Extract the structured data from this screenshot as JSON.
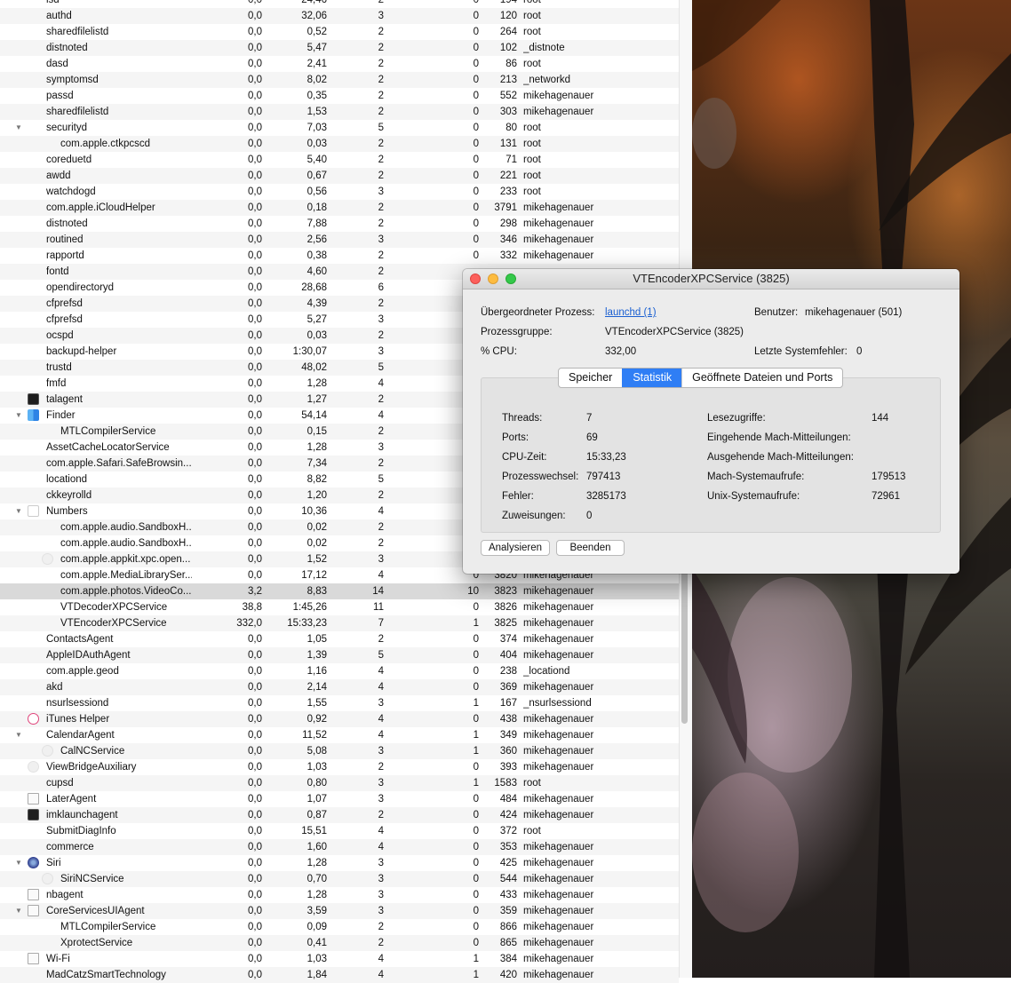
{
  "process_list": {
    "rows": [
      {
        "indent": 1,
        "name": "lsd",
        "cpu": "0,0",
        "time": "24,46",
        "threads": "2",
        "wakeups": "0",
        "pid": "194",
        "user": "root"
      },
      {
        "indent": 1,
        "name": "authd",
        "cpu": "0,0",
        "time": "32,06",
        "threads": "3",
        "wakeups": "0",
        "pid": "120",
        "user": "root"
      },
      {
        "indent": 1,
        "name": "sharedfilelistd",
        "cpu": "0,0",
        "time": "0,52",
        "threads": "2",
        "wakeups": "0",
        "pid": "264",
        "user": "root"
      },
      {
        "indent": 1,
        "name": "distnoted",
        "cpu": "0,0",
        "time": "5,47",
        "threads": "2",
        "wakeups": "0",
        "pid": "102",
        "user": "_distnote"
      },
      {
        "indent": 1,
        "name": "dasd",
        "cpu": "0,0",
        "time": "2,41",
        "threads": "2",
        "wakeups": "0",
        "pid": "86",
        "user": "root"
      },
      {
        "indent": 1,
        "name": "symptomsd",
        "cpu": "0,0",
        "time": "8,02",
        "threads": "2",
        "wakeups": "0",
        "pid": "213",
        "user": "_networkd"
      },
      {
        "indent": 1,
        "name": "passd",
        "cpu": "0,0",
        "time": "0,35",
        "threads": "2",
        "wakeups": "0",
        "pid": "552",
        "user": "mikehagenauer"
      },
      {
        "indent": 1,
        "name": "sharedfilelistd",
        "cpu": "0,0",
        "time": "1,53",
        "threads": "2",
        "wakeups": "0",
        "pid": "303",
        "user": "mikehagenauer"
      },
      {
        "indent": 1,
        "name": "securityd",
        "disclosure": "▼",
        "cpu": "0,0",
        "time": "7,03",
        "threads": "5",
        "wakeups": "0",
        "pid": "80",
        "user": "root"
      },
      {
        "indent": 2,
        "name": "com.apple.ctkpcscd",
        "cpu": "0,0",
        "time": "0,03",
        "threads": "2",
        "wakeups": "0",
        "pid": "131",
        "user": "root"
      },
      {
        "indent": 1,
        "name": "coreduetd",
        "cpu": "0,0",
        "time": "5,40",
        "threads": "2",
        "wakeups": "0",
        "pid": "71",
        "user": "root"
      },
      {
        "indent": 1,
        "name": "awdd",
        "cpu": "0,0",
        "time": "0,67",
        "threads": "2",
        "wakeups": "0",
        "pid": "221",
        "user": "root"
      },
      {
        "indent": 1,
        "name": "watchdogd",
        "cpu": "0,0",
        "time": "0,56",
        "threads": "3",
        "wakeups": "0",
        "pid": "233",
        "user": "root"
      },
      {
        "indent": 1,
        "name": "com.apple.iCloudHelper",
        "cpu": "0,0",
        "time": "0,18",
        "threads": "2",
        "wakeups": "0",
        "pid": "3791",
        "user": "mikehagenauer"
      },
      {
        "indent": 1,
        "name": "distnoted",
        "cpu": "0,0",
        "time": "7,88",
        "threads": "2",
        "wakeups": "0",
        "pid": "298",
        "user": "mikehagenauer"
      },
      {
        "indent": 1,
        "name": "routined",
        "cpu": "0,0",
        "time": "2,56",
        "threads": "3",
        "wakeups": "0",
        "pid": "346",
        "user": "mikehagenauer"
      },
      {
        "indent": 1,
        "name": "rapportd",
        "cpu": "0,0",
        "time": "0,38",
        "threads": "2",
        "wakeups": "0",
        "pid": "332",
        "user": "mikehagenauer"
      },
      {
        "indent": 1,
        "name": "fontd",
        "cpu": "0,0",
        "time": "4,60",
        "threads": "2",
        "wakeups": "",
        "pid": "",
        "user": ""
      },
      {
        "indent": 1,
        "name": "opendirectoryd",
        "cpu": "0,0",
        "time": "28,68",
        "threads": "6",
        "wakeups": "",
        "pid": "",
        "user": ""
      },
      {
        "indent": 1,
        "name": "cfprefsd",
        "cpu": "0,0",
        "time": "4,39",
        "threads": "2",
        "wakeups": "",
        "pid": "",
        "user": ""
      },
      {
        "indent": 1,
        "name": "cfprefsd",
        "cpu": "0,0",
        "time": "5,27",
        "threads": "3",
        "wakeups": "",
        "pid": "",
        "user": ""
      },
      {
        "indent": 1,
        "name": "ocspd",
        "cpu": "0,0",
        "time": "0,03",
        "threads": "2",
        "wakeups": "",
        "pid": "",
        "user": ""
      },
      {
        "indent": 1,
        "name": "backupd-helper",
        "cpu": "0,0",
        "time": "1:30,07",
        "threads": "3",
        "wakeups": "",
        "pid": "",
        "user": ""
      },
      {
        "indent": 1,
        "name": "trustd",
        "cpu": "0,0",
        "time": "48,02",
        "threads": "5",
        "wakeups": "",
        "pid": "",
        "user": ""
      },
      {
        "indent": 1,
        "name": "fmfd",
        "cpu": "0,0",
        "time": "1,28",
        "threads": "4",
        "wakeups": "",
        "pid": "",
        "user": ""
      },
      {
        "indent": 1,
        "name": "talagent",
        "icon": "terminal",
        "cpu": "0,0",
        "time": "1,27",
        "threads": "2",
        "wakeups": "",
        "pid": "",
        "user": ""
      },
      {
        "indent": 1,
        "name": "Finder",
        "icon": "finder",
        "disclosure": "▼",
        "cpu": "0,0",
        "time": "54,14",
        "threads": "4",
        "wakeups": "",
        "pid": "",
        "user": ""
      },
      {
        "indent": 2,
        "name": "MTLCompilerService",
        "cpu": "0,0",
        "time": "0,15",
        "threads": "2",
        "wakeups": "",
        "pid": "",
        "user": ""
      },
      {
        "indent": 1,
        "name": "AssetCacheLocatorService",
        "cpu": "0,0",
        "time": "1,28",
        "threads": "3",
        "wakeups": "",
        "pid": "",
        "user": ""
      },
      {
        "indent": 1,
        "name": "com.apple.Safari.SafeBrowsin...",
        "cpu": "0,0",
        "time": "7,34",
        "threads": "2",
        "wakeups": "",
        "pid": "",
        "user": ""
      },
      {
        "indent": 1,
        "name": "locationd",
        "cpu": "0,0",
        "time": "8,82",
        "threads": "5",
        "wakeups": "",
        "pid": "",
        "user": ""
      },
      {
        "indent": 1,
        "name": "ckkeyrolld",
        "cpu": "0,0",
        "time": "1,20",
        "threads": "2",
        "wakeups": "",
        "pid": "",
        "user": ""
      },
      {
        "indent": 1,
        "name": "Numbers",
        "icon": "numbers",
        "disclosure": "▼",
        "cpu": "0,0",
        "time": "10,36",
        "threads": "4",
        "wakeups": "",
        "pid": "",
        "user": ""
      },
      {
        "indent": 2,
        "name": "com.apple.audio.SandboxH...",
        "cpu": "0,0",
        "time": "0,02",
        "threads": "2",
        "wakeups": "",
        "pid": "",
        "user": ""
      },
      {
        "indent": 2,
        "name": "com.apple.audio.SandboxH...",
        "cpu": "0,0",
        "time": "0,02",
        "threads": "2",
        "wakeups": "",
        "pid": "",
        "user": ""
      },
      {
        "indent": 2,
        "name": "com.apple.appkit.xpc.open...",
        "icon": "ghost2",
        "cpu": "0,0",
        "time": "1,52",
        "threads": "3",
        "wakeups": "",
        "pid": "",
        "user": ""
      },
      {
        "indent": 2,
        "name": "com.apple.MediaLibrarySer...",
        "cpu": "0,0",
        "time": "17,12",
        "threads": "4",
        "wakeups": "0",
        "pid": "3820",
        "user": "mikehagenauer"
      },
      {
        "indent": 2,
        "name": "com.apple.photos.VideoCo...",
        "selected": true,
        "cpu": "3,2",
        "time": "8,83",
        "threads": "14",
        "wakeups": "10",
        "pid": "3823",
        "user": "mikehagenauer"
      },
      {
        "indent": 2,
        "name": "VTDecoderXPCService",
        "cpu": "38,8",
        "time": "1:45,26",
        "threads": "11",
        "wakeups": "0",
        "pid": "3826",
        "user": "mikehagenauer"
      },
      {
        "indent": 2,
        "name": "VTEncoderXPCService",
        "cpu": "332,0",
        "time": "15:33,23",
        "threads": "7",
        "wakeups": "1",
        "pid": "3825",
        "user": "mikehagenauer"
      },
      {
        "indent": 1,
        "name": "ContactsAgent",
        "cpu": "0,0",
        "time": "1,05",
        "threads": "2",
        "wakeups": "0",
        "pid": "374",
        "user": "mikehagenauer"
      },
      {
        "indent": 1,
        "name": "AppleIDAuthAgent",
        "cpu": "0,0",
        "time": "1,39",
        "threads": "5",
        "wakeups": "0",
        "pid": "404",
        "user": "mikehagenauer"
      },
      {
        "indent": 1,
        "name": "com.apple.geod",
        "cpu": "0,0",
        "time": "1,16",
        "threads": "4",
        "wakeups": "0",
        "pid": "238",
        "user": "_locationd"
      },
      {
        "indent": 1,
        "name": "akd",
        "cpu": "0,0",
        "time": "2,14",
        "threads": "4",
        "wakeups": "0",
        "pid": "369",
        "user": "mikehagenauer"
      },
      {
        "indent": 1,
        "name": "nsurlsessiond",
        "cpu": "0,0",
        "time": "1,55",
        "threads": "3",
        "wakeups": "1",
        "pid": "167",
        "user": "_nsurlsessiond"
      },
      {
        "indent": 1,
        "name": "iTunes Helper",
        "icon": "itunes",
        "cpu": "0,0",
        "time": "0,92",
        "threads": "4",
        "wakeups": "0",
        "pid": "438",
        "user": "mikehagenauer"
      },
      {
        "indent": 1,
        "name": "CalendarAgent",
        "disclosure": "▼",
        "cpu": "0,0",
        "time": "11,52",
        "threads": "4",
        "wakeups": "1",
        "pid": "349",
        "user": "mikehagenauer"
      },
      {
        "indent": 2,
        "name": "CalNCService",
        "icon": "ghost2",
        "cpu": "0,0",
        "time": "5,08",
        "threads": "3",
        "wakeups": "1",
        "pid": "360",
        "user": "mikehagenauer"
      },
      {
        "indent": 1,
        "name": "ViewBridgeAuxiliary",
        "icon": "ghost",
        "cpu": "0,0",
        "time": "1,03",
        "threads": "2",
        "wakeups": "0",
        "pid": "393",
        "user": "mikehagenauer"
      },
      {
        "indent": 1,
        "name": "cupsd",
        "cpu": "0,0",
        "time": "0,80",
        "threads": "3",
        "wakeups": "1",
        "pid": "1583",
        "user": "root"
      },
      {
        "indent": 1,
        "name": "LaterAgent",
        "icon": "doc",
        "cpu": "0,0",
        "time": "1,07",
        "threads": "3",
        "wakeups": "0",
        "pid": "484",
        "user": "mikehagenauer"
      },
      {
        "indent": 1,
        "name": "imklaunchagent",
        "icon": "terminal",
        "cpu": "0,0",
        "time": "0,87",
        "threads": "2",
        "wakeups": "0",
        "pid": "424",
        "user": "mikehagenauer"
      },
      {
        "indent": 1,
        "name": "SubmitDiagInfo",
        "cpu": "0,0",
        "time": "15,51",
        "threads": "4",
        "wakeups": "0",
        "pid": "372",
        "user": "root"
      },
      {
        "indent": 1,
        "name": "commerce",
        "cpu": "0,0",
        "time": "1,60",
        "threads": "4",
        "wakeups": "0",
        "pid": "353",
        "user": "mikehagenauer"
      },
      {
        "indent": 1,
        "name": "Siri",
        "icon": "siri",
        "disclosure": "▼",
        "cpu": "0,0",
        "time": "1,28",
        "threads": "3",
        "wakeups": "0",
        "pid": "425",
        "user": "mikehagenauer"
      },
      {
        "indent": 2,
        "name": "SiriNCService",
        "icon": "ghost2",
        "cpu": "0,0",
        "time": "0,70",
        "threads": "3",
        "wakeups": "0",
        "pid": "544",
        "user": "mikehagenauer"
      },
      {
        "indent": 1,
        "name": "nbagent",
        "icon": "doc",
        "cpu": "0,0",
        "time": "1,28",
        "threads": "3",
        "wakeups": "0",
        "pid": "433",
        "user": "mikehagenauer"
      },
      {
        "indent": 1,
        "name": "CoreServicesUIAgent",
        "icon": "doc",
        "disclosure": "▼",
        "cpu": "0,0",
        "time": "3,59",
        "threads": "3",
        "wakeups": "0",
        "pid": "359",
        "user": "mikehagenauer"
      },
      {
        "indent": 2,
        "name": "MTLCompilerService",
        "cpu": "0,0",
        "time": "0,09",
        "threads": "2",
        "wakeups": "0",
        "pid": "866",
        "user": "mikehagenauer"
      },
      {
        "indent": 2,
        "name": "XprotectService",
        "cpu": "0,0",
        "time": "0,41",
        "threads": "2",
        "wakeups": "0",
        "pid": "865",
        "user": "mikehagenauer"
      },
      {
        "indent": 1,
        "name": "Wi-Fi",
        "icon": "doc",
        "cpu": "0,0",
        "time": "1,03",
        "threads": "4",
        "wakeups": "1",
        "pid": "384",
        "user": "mikehagenauer"
      },
      {
        "indent": 1,
        "name": "MadCatzSmartTechnology",
        "cpu": "0,0",
        "time": "1,84",
        "threads": "4",
        "wakeups": "1",
        "pid": "420",
        "user": "mikehagenauer"
      }
    ]
  },
  "inspector": {
    "title": "VTEncoderXPCService (3825)",
    "parent_label": "Übergeordneter Prozess:",
    "parent_value": "launchd (1)",
    "user_label": "Benutzer:",
    "user_value": "mikehagenauer (501)",
    "group_label": "Prozessgruppe:",
    "group_value": "VTEncoderXPCService (3825)",
    "cpu_label": "% CPU:",
    "cpu_value": "332,00",
    "faults_label": "Letzte Systemfehler:",
    "faults_value": "0",
    "tabs": [
      {
        "label": "Speicher",
        "active": false
      },
      {
        "label": "Statistik",
        "active": true
      },
      {
        "label": "Geöffnete Dateien und Ports",
        "active": false
      }
    ],
    "stats_left": [
      {
        "label": "Threads:",
        "value": "7"
      },
      {
        "label": "Ports:",
        "value": "69"
      },
      {
        "label": "CPU-Zeit:",
        "value": "15:33,23"
      },
      {
        "label": "Prozesswechsel:",
        "value": "797413"
      },
      {
        "label": "Fehler:",
        "value": "3285173"
      },
      {
        "label": "Zuweisungen:",
        "value": "0"
      }
    ],
    "stats_right": [
      {
        "label": "Lesezugriffe:",
        "value": "144"
      },
      {
        "label": "Eingehende Mach-Mitteilungen:",
        "value": ""
      },
      {
        "label": "Ausgehende Mach-Mitteilungen:",
        "value": ""
      },
      {
        "label": "Mach-Systemaufrufe:",
        "value": "179513"
      },
      {
        "label": "Unix-Systemaufrufe:",
        "value": "72961"
      }
    ],
    "analyze_button": "Analysieren",
    "quit_button": "Beenden"
  },
  "colors": {
    "accent": "#2f7ef5",
    "link": "#1a5fd1",
    "selected_row": "#d9d9d9"
  }
}
